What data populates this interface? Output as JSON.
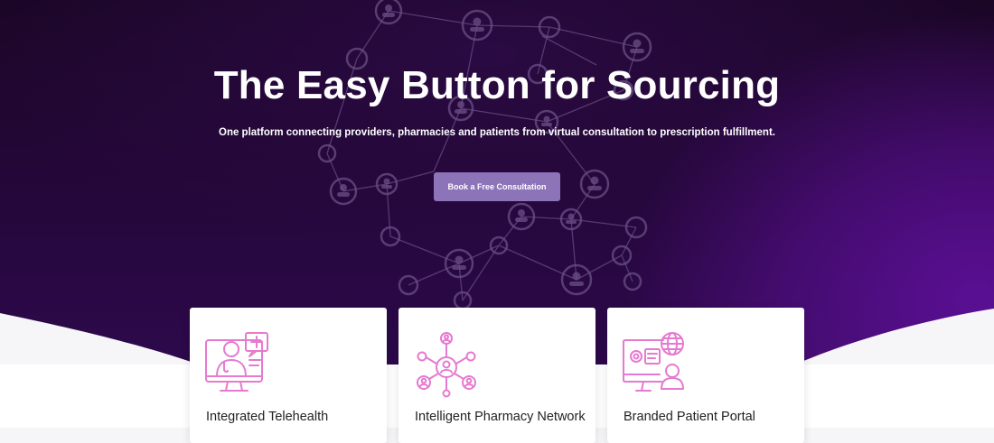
{
  "hero": {
    "title": "The Easy Button for Sourcing",
    "subtitle": "One platform connecting providers, pharmacies and patients from virtual consultation to prescription fulfillment.",
    "cta_label": "Book a Free Consultation"
  },
  "cards": [
    {
      "title": "Integrated Telehealth",
      "icon": "telehealth-icon"
    },
    {
      "title": "Intelligent Pharmacy Network",
      "icon": "network-icon"
    },
    {
      "title": "Branded Patient Portal",
      "icon": "patient-portal-icon"
    }
  ],
  "colors": {
    "hero_dark": "#1b0626",
    "hero_purple": "#5a0f93",
    "cta": "#8d74b8",
    "icon_pink": "#e57ad0"
  }
}
